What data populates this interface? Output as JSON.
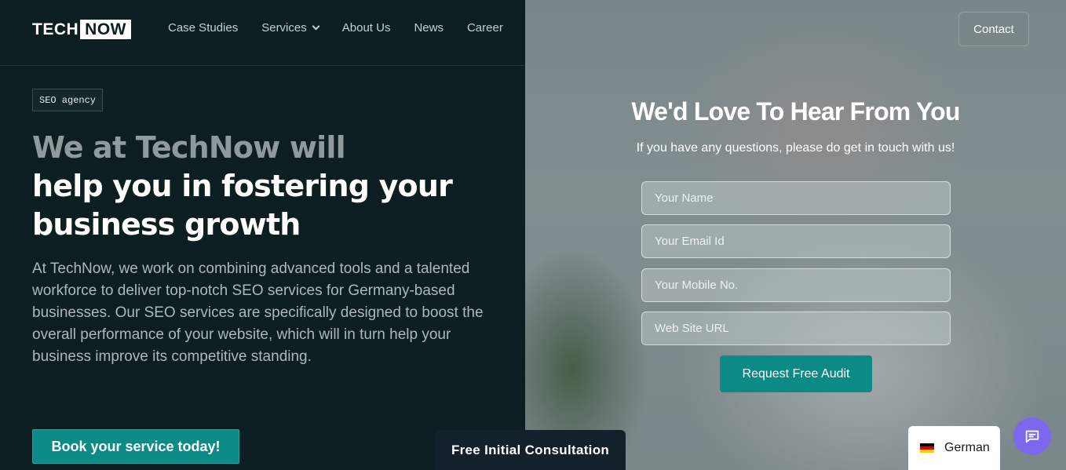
{
  "brand": {
    "logo_part1": "TECH",
    "logo_part2": "NOW"
  },
  "nav": {
    "items": [
      {
        "label": "Case Studies"
      },
      {
        "label": "Services"
      },
      {
        "label": "About Us"
      },
      {
        "label": "News"
      },
      {
        "label": "Career"
      }
    ],
    "contact_label": "Contact"
  },
  "hero": {
    "badge": "SEO agency",
    "heading_line1": "We at TechNow will",
    "heading_line2": "help you in fostering your",
    "heading_line3": "business growth",
    "paragraph": "At TechNow, we work on combining advanced tools and a talented workforce to deliver top-notch SEO services for Germany-based businesses. Our SEO services are specifically designed to boost the overall performance of your website, which will in turn help your business improve its competitive standing.",
    "cta_label": "Book your service today!"
  },
  "consultation_tab": "Free Initial Consultation",
  "form": {
    "title": "We'd Love To Hear From You",
    "subtitle": "If you have any questions, please do get in touch with us!",
    "name_placeholder": "Your Name",
    "email_placeholder": "Your Email Id",
    "mobile_placeholder": "Your Mobile No.",
    "url_placeholder": "Web Site URL",
    "submit_label": "Request Free Audit"
  },
  "language": {
    "label": "German",
    "flag_icon": "german-flag-icon"
  },
  "chat": {
    "icon": "chat-bubble-icon"
  },
  "colors": {
    "accent": "#0c8a86",
    "dark_bg": "#0c1e22",
    "chat": "#7b68ee"
  }
}
